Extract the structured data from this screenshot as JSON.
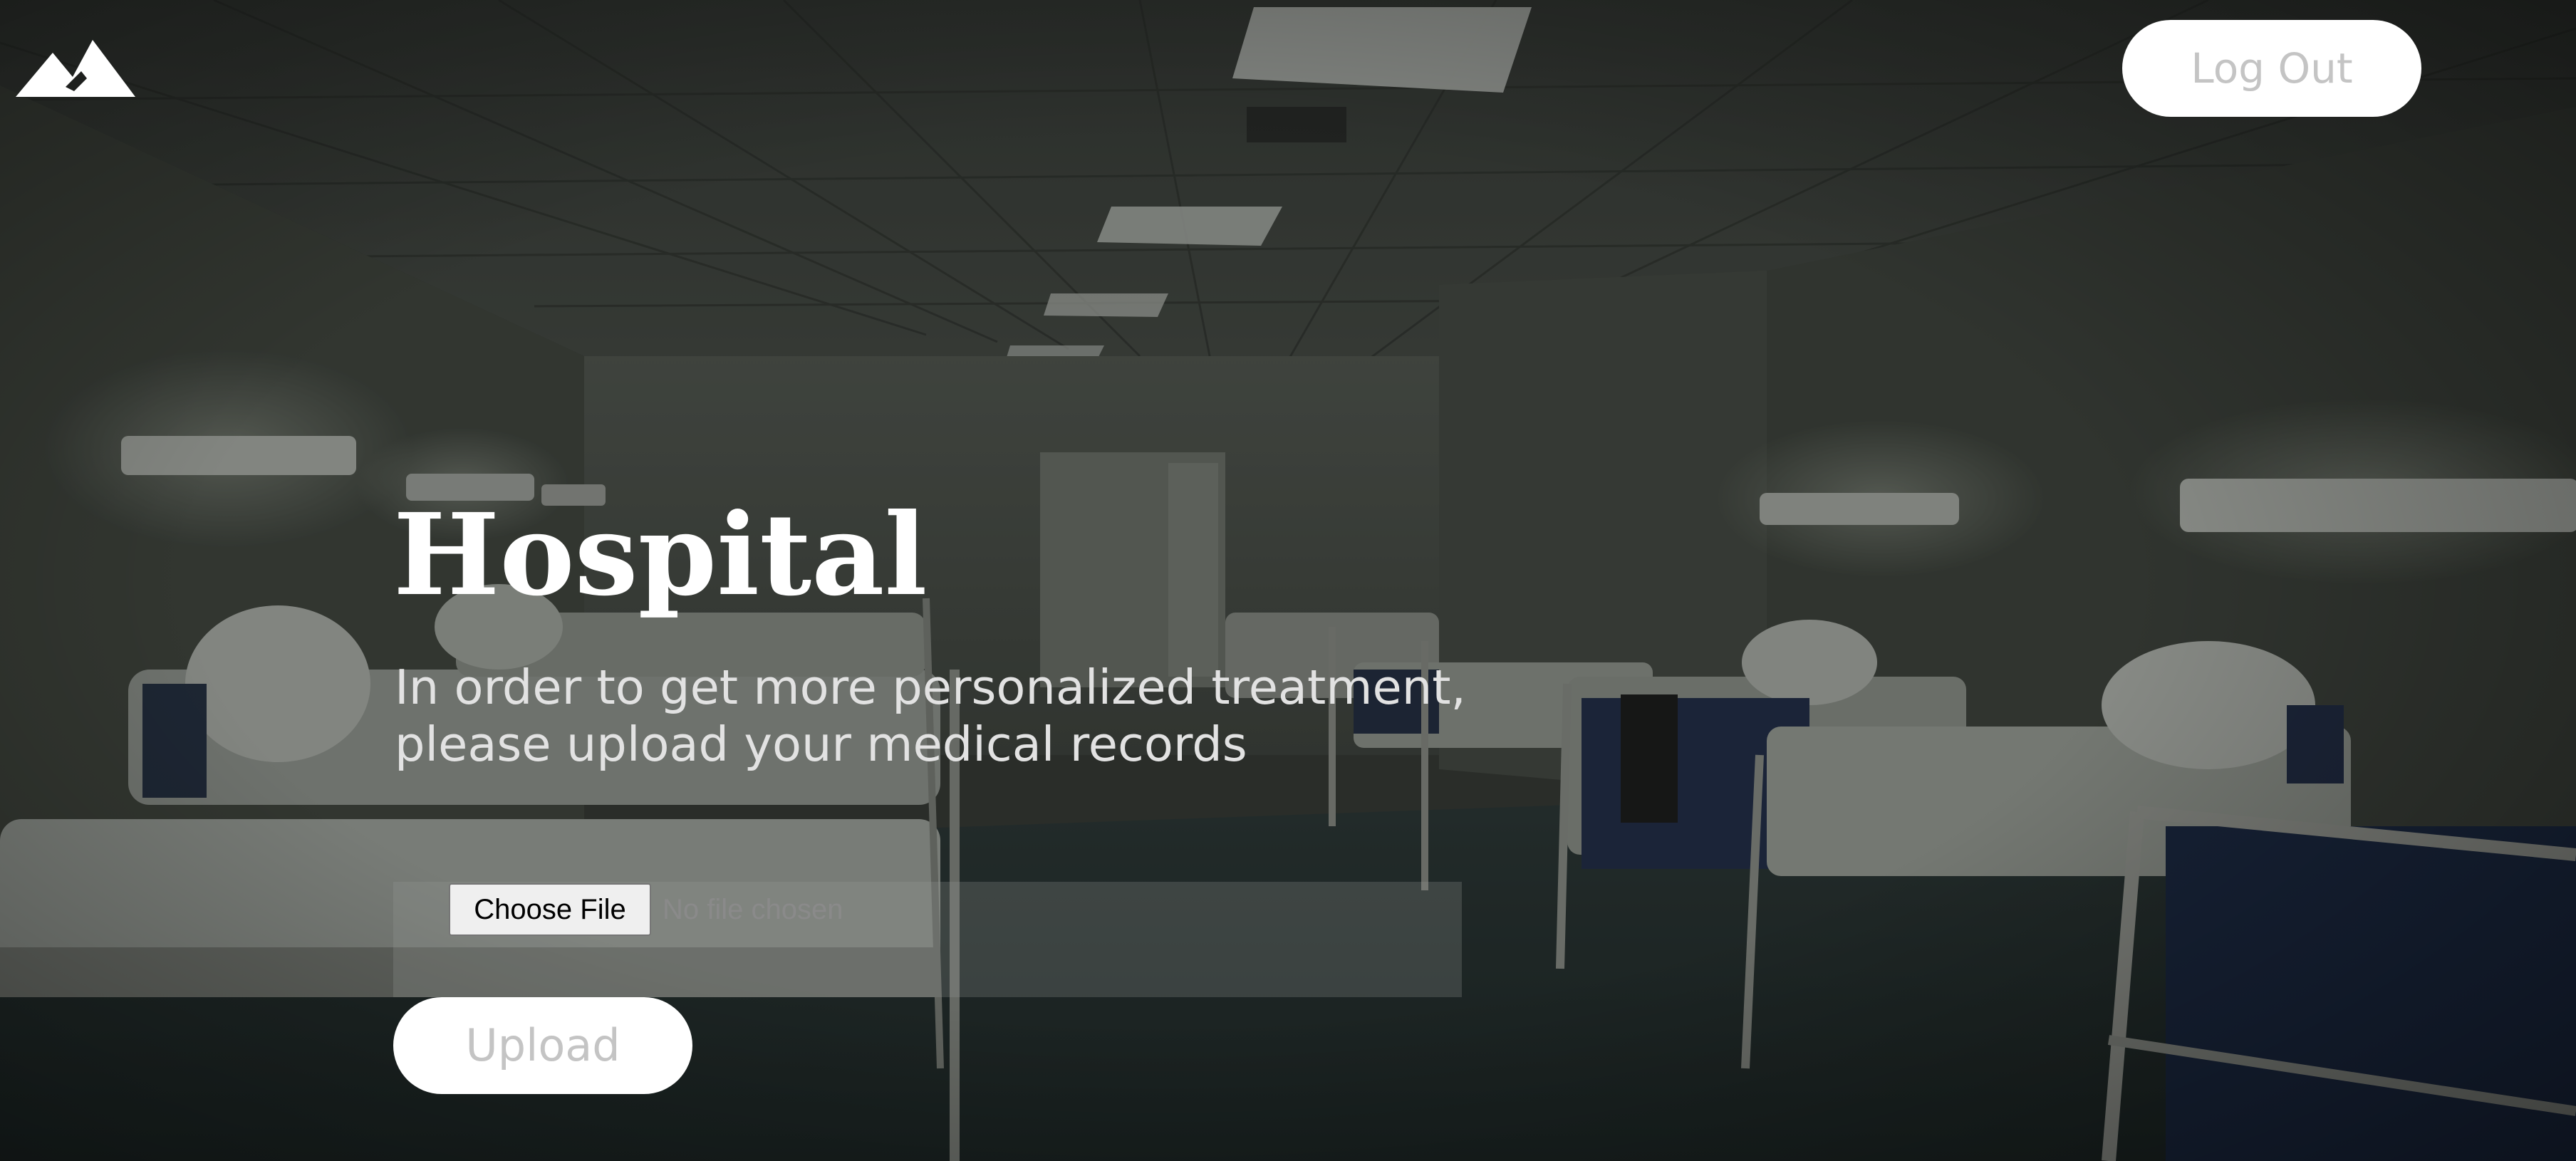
{
  "header": {
    "logo_icon": "mountain-logo-icon",
    "logout_label": "Log Out"
  },
  "hero": {
    "title": "Hospital",
    "subtitle_line1": "In order to get more personalized treatment,",
    "subtitle_line2": "please upload your medical records"
  },
  "upload_form": {
    "choose_file_label": "Choose File",
    "file_status": "No file chosen",
    "upload_label": "Upload"
  },
  "colors": {
    "overlay": "#1e201e",
    "button_bg": "#ffffff",
    "button_text": "#c4c4c4",
    "title_text": "#ffffff"
  }
}
